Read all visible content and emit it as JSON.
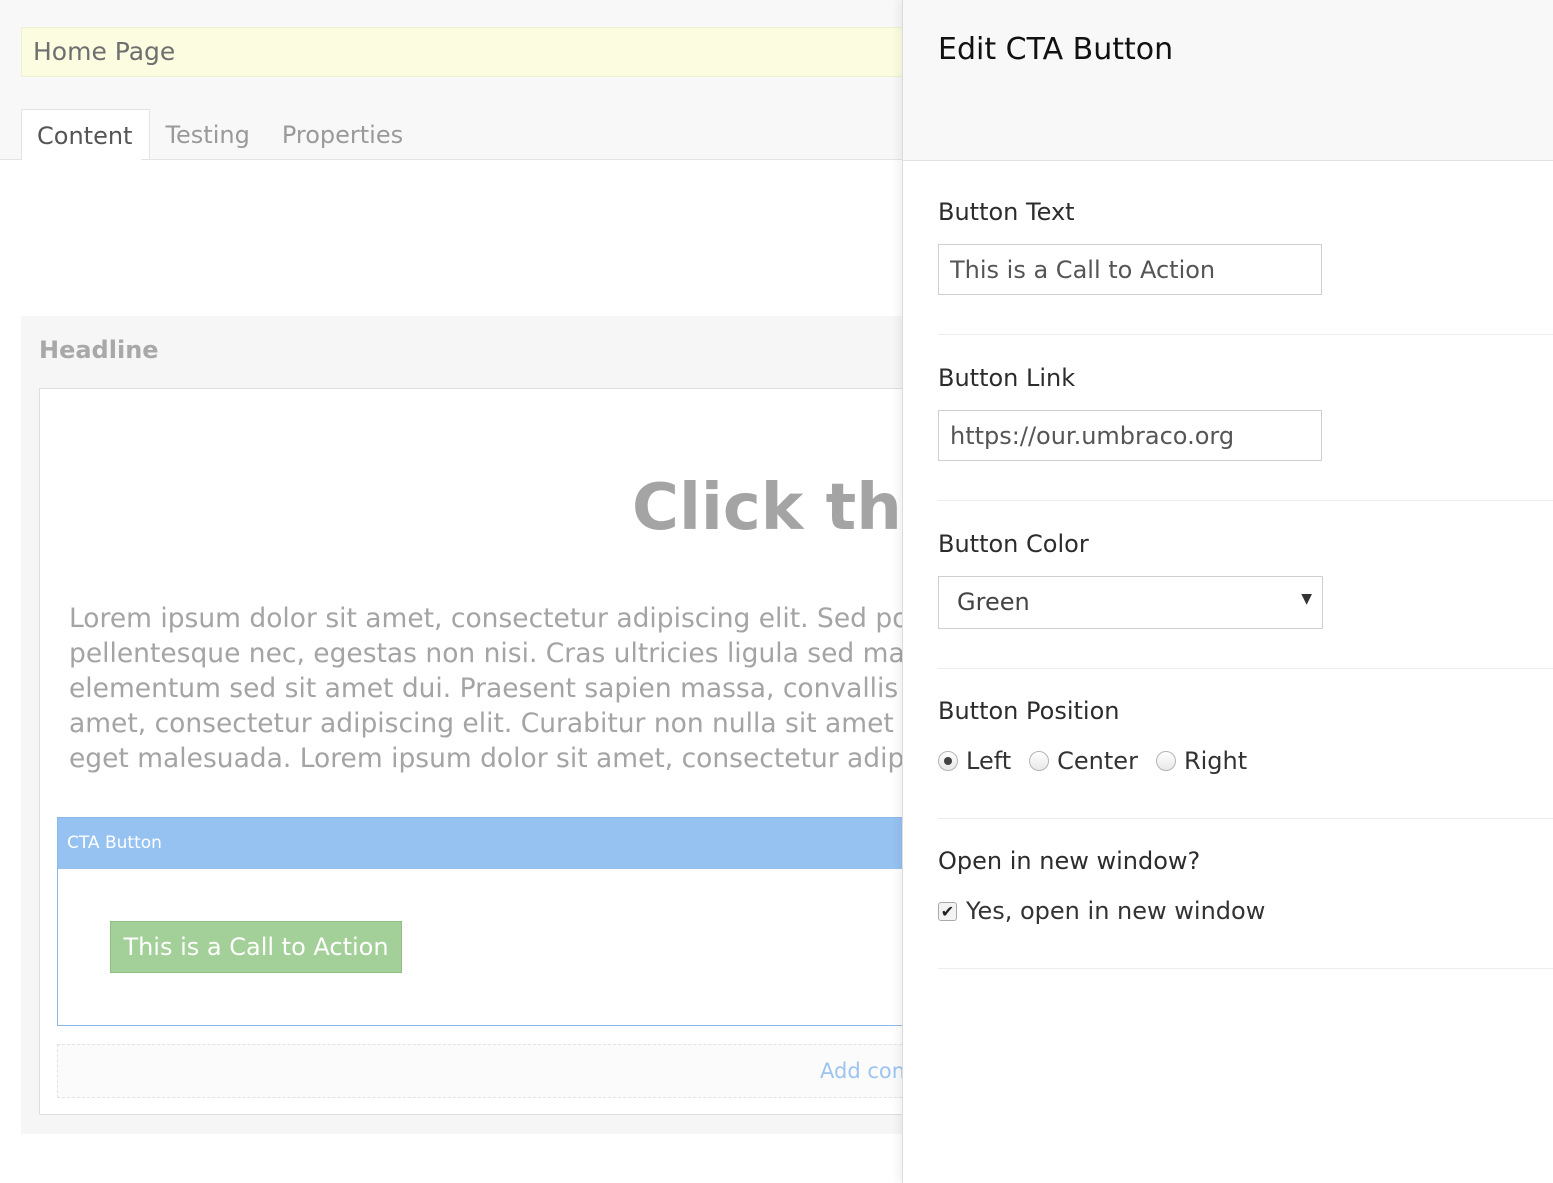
{
  "node": {
    "name": "Home Page"
  },
  "tabs": [
    {
      "label": "Content"
    },
    {
      "label": "Testing"
    },
    {
      "label": "Properties"
    }
  ],
  "grid": {
    "title": "Headline",
    "headline": "Click the",
    "lorem_lines": [
      "Lorem ipsum dolor sit amet, consectetur adipiscing elit. Sed port",
      "pellentesque nec, egestas non nisi. Cras ultricies ligula sed magn",
      "elementum sed sit amet dui. Praesent sapien massa, convallis a",
      "amet, consectetur adipiscing elit. Curabitur non nulla sit amet ni",
      "eget malesuada. Lorem ipsum dolor sit amet, consectetur adipis"
    ],
    "cta_block_label": "CTA Button",
    "cta_preview_text": "This is a Call to Action",
    "add_content_label": "Add con"
  },
  "dialog": {
    "title": "Edit CTA Button",
    "button_text": {
      "label": "Button Text",
      "value": "This is a Call to Action"
    },
    "button_link": {
      "label": "Button Link",
      "value": "https://our.umbraco.org"
    },
    "button_color": {
      "label": "Button Color",
      "value": "Green"
    },
    "button_position": {
      "label": "Button Position",
      "options": [
        "Left",
        "Center",
        "Right"
      ],
      "selected": "Left"
    },
    "new_window": {
      "label": "Open in new window?",
      "checkbox_label": "Yes, open in new window",
      "checked": true
    }
  },
  "colors": {
    "cta_green": "#a3cf98",
    "cta_header_blue": "#96c2f2",
    "node_name_bg": "#fcfde0"
  }
}
